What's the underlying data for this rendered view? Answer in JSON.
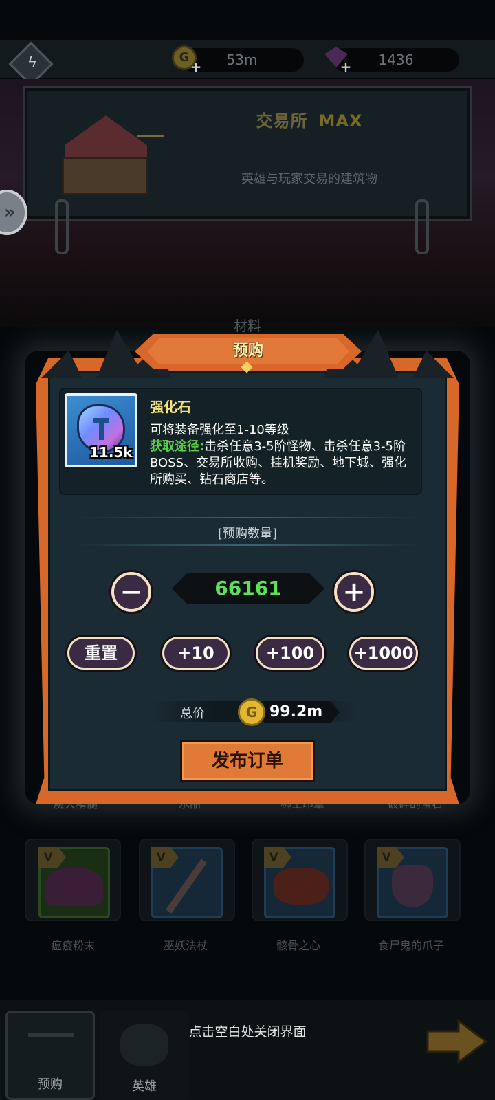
{
  "topbar": {
    "gold": "53m",
    "gems": "1436",
    "gold_icon": "gold-coin-icon",
    "gem_icon": "purple-gem-icon"
  },
  "building": {
    "title": "交易所",
    "level": "MAX",
    "description": "英雄与玩家交易的建筑物"
  },
  "background": {
    "tab_label": "材料",
    "row1_labels": [
      "魔犬精髓",
      "水晶",
      "狮王印章",
      "破碎的宝石"
    ],
    "row2_labels": [
      "瘟疫粉末",
      "巫妖法杖",
      "骸骨之心",
      "食尸鬼的爪子"
    ]
  },
  "modal": {
    "title": "预购",
    "item": {
      "name": "强化石",
      "count": "11.5k",
      "line1": "可将装备强化至1-10等级",
      "source_label": "获取途径:",
      "source_text": "击杀任意3-5阶怪物、击杀任意3-5阶BOSS、交易所收购、挂机奖励、地下城、强化所购买、钻石商店等。"
    },
    "quantity_label": "[预购数量]",
    "quantity": "66161",
    "minus": "−",
    "plus": "+",
    "quick_buttons": [
      "重置",
      "+10",
      "+100",
      "+1000"
    ],
    "total_label": "总价",
    "total_value": "99.2m",
    "publish_label": "发布订单"
  },
  "bottom": {
    "close_hint": "点击空白处关闭界面",
    "tabs": [
      "预购",
      "英雄"
    ]
  },
  "colors": {
    "accent_orange": "#d8672a",
    "panel": "#1b2b33",
    "qty_green": "#5ee05a",
    "item_name_yellow": "#f5e27a"
  }
}
